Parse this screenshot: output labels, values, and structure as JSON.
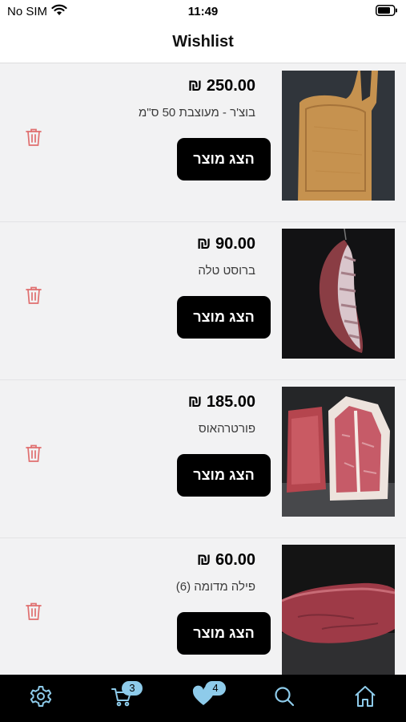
{
  "status_bar": {
    "carrier": "No SIM",
    "time": "11:49"
  },
  "header": {
    "title": "Wishlist"
  },
  "items": [
    {
      "price": "₪ 250.00",
      "name": "בוצ'ר - מעוצבת 50 ס\"מ",
      "button": "הצג מוצר",
      "image": "cutting-board"
    },
    {
      "price": "₪ 90.00",
      "name": "ברוסט טלה",
      "button": "הצג מוצר",
      "image": "lamb-rack"
    },
    {
      "price": "₪ 185.00",
      "name": "פורטרהאוס",
      "button": "הצג מוצר",
      "image": "porterhouse-steak"
    },
    {
      "price": "₪ 60.00",
      "name": "פילה מדומה (6)",
      "button": "הצג מוצר",
      "image": "beef-fillet"
    }
  ],
  "tabbar": {
    "tabs": [
      {
        "icon": "gear-icon"
      },
      {
        "icon": "cart-icon",
        "badge": "3"
      },
      {
        "icon": "heart-icon",
        "badge": "4"
      },
      {
        "icon": "search-icon"
      },
      {
        "icon": "home-icon"
      }
    ]
  },
  "colors": {
    "accent": "#8ecbea",
    "trash": "#e06f6f",
    "button_bg": "#000000",
    "tabbar_bg": "#000000"
  }
}
